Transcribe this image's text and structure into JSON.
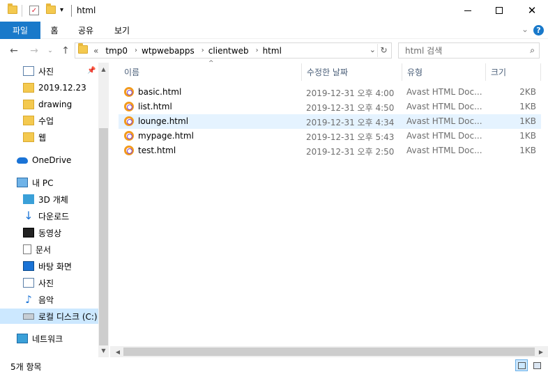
{
  "window": {
    "title": "html",
    "minimize_icon": "minimize-icon",
    "maximize_icon": "maximize-icon",
    "close_icon": "close-icon"
  },
  "ribbon": {
    "tabs": [
      {
        "label": "파일"
      },
      {
        "label": "홈"
      },
      {
        "label": "공유"
      },
      {
        "label": "보기"
      }
    ],
    "help_label": "?",
    "accent": "#1979ca"
  },
  "address": {
    "prefix": "«",
    "crumbs": [
      "tmp0",
      "wtpwebapps",
      "clientweb",
      "html"
    ]
  },
  "search": {
    "placeholder": "html 검색"
  },
  "nav": {
    "items": [
      {
        "label": "사진",
        "icon": "picture-icon"
      },
      {
        "label": "2019.12.23",
        "icon": "folder-icon"
      },
      {
        "label": "drawing",
        "icon": "folder-icon"
      },
      {
        "label": "수업",
        "icon": "folder-icon"
      },
      {
        "label": "웹",
        "icon": "folder-icon"
      },
      {
        "label": "OneDrive",
        "icon": "cloud-icon"
      },
      {
        "label": "내 PC",
        "icon": "computer-icon"
      },
      {
        "label": "3D 개체",
        "icon": "3d-objects-icon"
      },
      {
        "label": "다운로드",
        "icon": "download-icon"
      },
      {
        "label": "동영상",
        "icon": "video-icon"
      },
      {
        "label": "문서",
        "icon": "document-icon"
      },
      {
        "label": "바탕 화면",
        "icon": "desktop-icon"
      },
      {
        "label": "사진",
        "icon": "picture-icon"
      },
      {
        "label": "음악",
        "icon": "music-icon"
      },
      {
        "label": "로컬 디스크 (C:)",
        "icon": "disk-icon"
      },
      {
        "label": "네트워크",
        "icon": "network-icon"
      }
    ],
    "selected_label": "로컬 디스크 (C:)"
  },
  "columns": {
    "name": "이름",
    "date": "수정한 날짜",
    "type": "유형",
    "size": "크기"
  },
  "files": [
    {
      "name": "basic.html",
      "date": "2019-12-31 오후 4:00",
      "type": "Avast HTML Doc...",
      "size": "2KB"
    },
    {
      "name": "list.html",
      "date": "2019-12-31 오후 4:50",
      "type": "Avast HTML Doc...",
      "size": "1KB"
    },
    {
      "name": "lounge.html",
      "date": "2019-12-31 오후 4:34",
      "type": "Avast HTML Doc...",
      "size": "1KB"
    },
    {
      "name": "mypage.html",
      "date": "2019-12-31 오후 5:43",
      "type": "Avast HTML Doc...",
      "size": "1KB"
    },
    {
      "name": "test.html",
      "date": "2019-12-31 오후 2:50",
      "type": "Avast HTML Doc...",
      "size": "1KB"
    }
  ],
  "highlighted_file": "lounge.html",
  "status": {
    "count": "5개 항목"
  }
}
